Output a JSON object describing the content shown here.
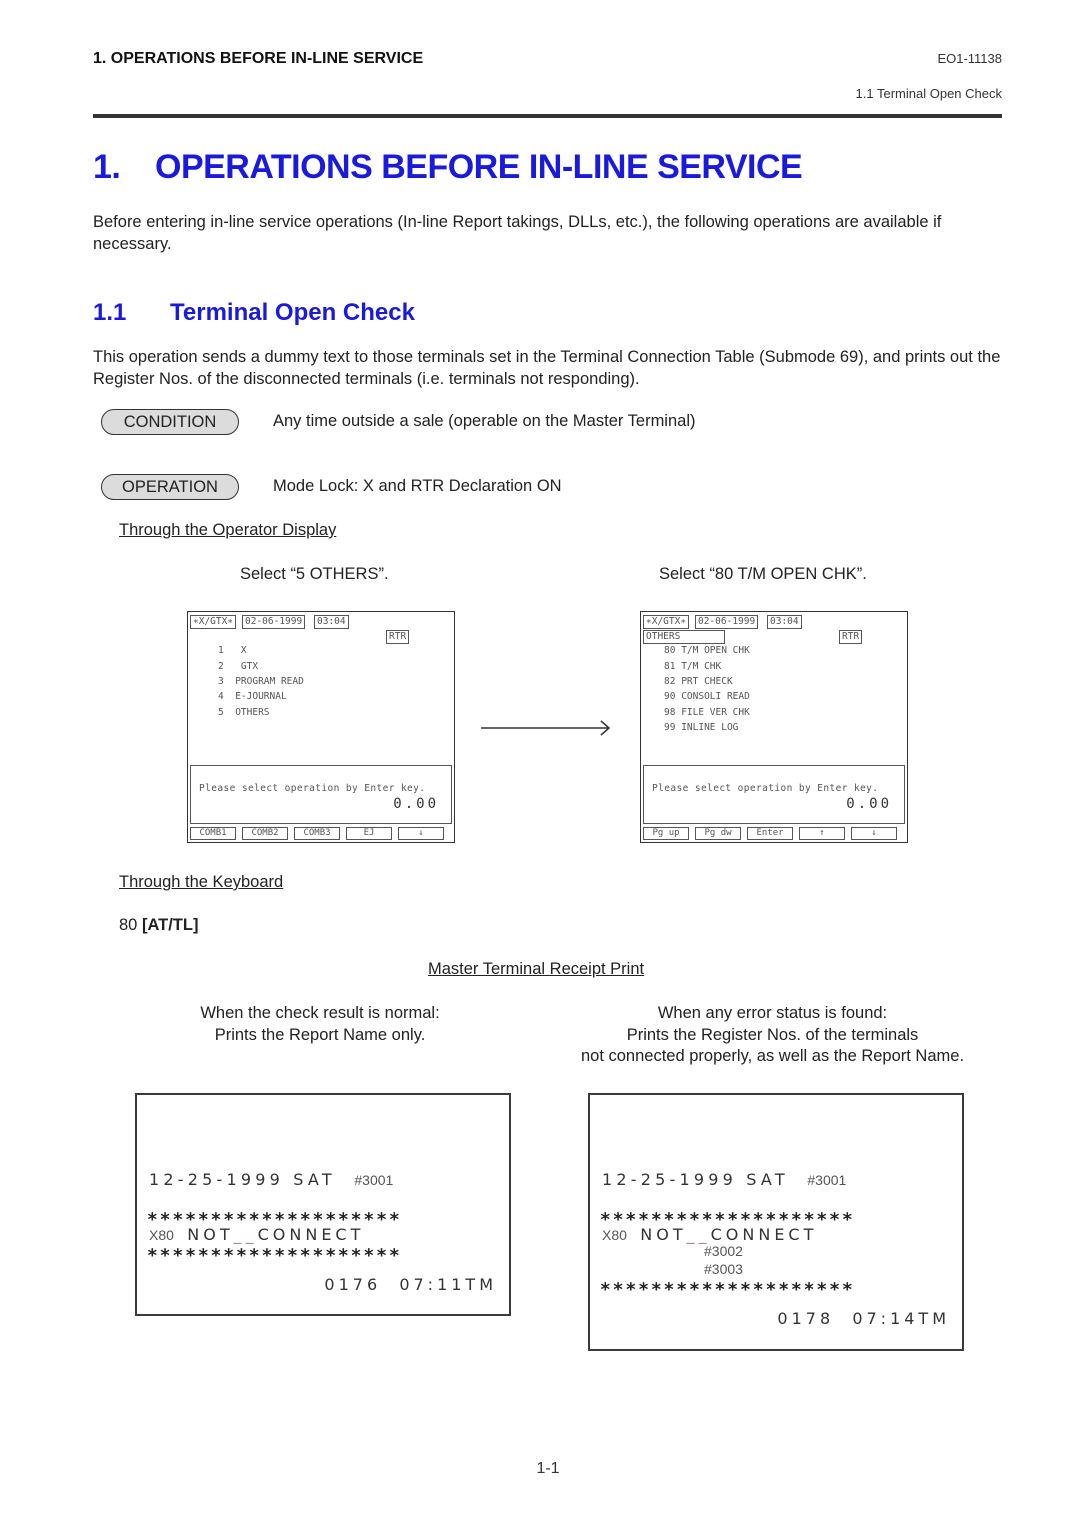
{
  "running_header": {
    "chapter_title": "1.  OPERATIONS BEFORE IN-LINE SERVICE",
    "doc_code": "EO1-11138",
    "section_ref": "1.1  Terminal Open Check"
  },
  "chapter": {
    "number": "1.",
    "title": "OPERATIONS BEFORE IN-LINE SERVICE",
    "intro": "Before entering in-line service operations (In-line Report takings, DLLs, etc.), the following operations are available if necessary."
  },
  "section": {
    "number": "1.1",
    "title": "Terminal Open Check",
    "description": "This operation sends a dummy text to those terminals set in the Terminal Connection Table (Submode 69), and prints out the Register Nos. of the disconnected terminals (i.e. terminals not responding).",
    "condition": {
      "label": "CONDITION",
      "text": "Any time outside a sale (operable on the Master Terminal)"
    },
    "operation": {
      "label": "OPERATION",
      "text": "Mode Lock:  X and RTR Declaration ON"
    },
    "operator_display": {
      "heading": "Through the Operator Display",
      "step1_caption": "Select “5 OTHERS”.",
      "step2_caption": "Select “80 T/M OPEN CHK”.",
      "screen1": {
        "mode": "∗X/GTX∗",
        "date": "02-06-1999",
        "time": "03:04",
        "rtr": "RTR",
        "menu": [
          {
            "num": "1",
            "label": " X"
          },
          {
            "num": "2",
            "label": " GTX"
          },
          {
            "num": "3",
            "label": "PROGRAM READ"
          },
          {
            "num": "4",
            "label": "E-JOURNAL"
          },
          {
            "num": "5",
            "label": "OTHERS"
          }
        ],
        "message": "Please select operation by Enter key.",
        "amount": "0.00",
        "fkeys": [
          "COMB1",
          "COMB2",
          "COMB3",
          "EJ",
          "↓"
        ]
      },
      "screen2": {
        "mode": "∗X/GTX∗",
        "date": "02-06-1999",
        "time": "03:04",
        "title": "OTHERS",
        "rtr": "RTR",
        "menu": [
          {
            "num": "80",
            "label": "T/M OPEN CHK"
          },
          {
            "num": "81",
            "label": "T/M CHK"
          },
          {
            "num": "82",
            "label": "PRT CHECK"
          },
          {
            "num": "90",
            "label": "CONSOLI READ"
          },
          {
            "num": "98",
            "label": "FILE VER CHK"
          },
          {
            "num": "99",
            "label": "INLINE LOG"
          }
        ],
        "message": "Please select operation by Enter key.",
        "amount": "0.00",
        "fkeys": [
          "Pg up",
          "Pg dw",
          "Enter",
          "↑",
          "↓"
        ]
      }
    },
    "keyboard": {
      "heading": "Through the Keyboard",
      "sequence_number": "80",
      "sequence_key": "[AT/TL]"
    },
    "receipt_print": {
      "heading": "Master Terminal Receipt Print",
      "normal": {
        "caption_line1": "When the check result is normal:",
        "caption_line2": "Prints the Report Name only.",
        "date": "12-25-1999",
        "day": "SAT",
        "register": "#3001",
        "stars": "∗∗∗∗∗∗∗∗∗∗∗∗∗∗∗∗∗∗∗∗",
        "report_code": "X80",
        "report_name_a": "NOT",
        "report_name_sep": "__",
        "report_name_b": "CONNECT",
        "footer": "0176  07:11TM"
      },
      "error": {
        "caption_line1": "When any error status is found:",
        "caption_line2": "Prints the Register Nos. of the terminals",
        "caption_line3": "not connected properly, as well as the Report Name.",
        "date": "12-25-1999",
        "day": "SAT",
        "register": "#3001",
        "stars": "∗∗∗∗∗∗∗∗∗∗∗∗∗∗∗∗∗∗∗∗",
        "report_code": "X80",
        "report_name_a": "NOT",
        "report_name_sep": "__",
        "report_name_b": "CONNECT",
        "disconnected": [
          "#3002",
          "#3003"
        ],
        "footer": "0178  07:14TM"
      }
    }
  },
  "page_number": "1-1",
  "colors": {
    "heading_blue": "#1a1adc",
    "pill_fill": "#dcdcdc"
  }
}
